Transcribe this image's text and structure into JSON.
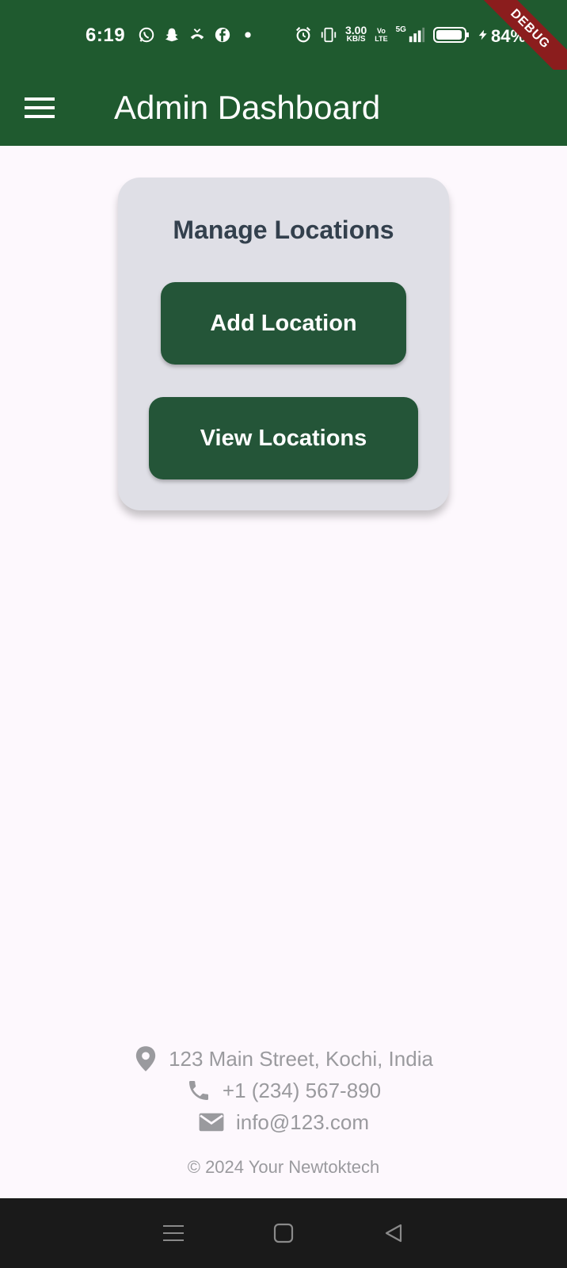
{
  "status_bar": {
    "time": "6:19",
    "net_speed_value": "3.00",
    "net_speed_unit": "KB/S",
    "volte_top": "Vo",
    "volte_bottom": "LTE",
    "network": "5G",
    "battery": "84%",
    "left_icons": [
      "whatsapp-icon",
      "snapchat-icon",
      "missed-call-icon",
      "facebook-icon",
      "dot-icon"
    ],
    "right_icons": [
      "alarm-icon",
      "vibrate-icon",
      "signal-icon",
      "battery-icon",
      "charging-icon"
    ]
  },
  "debug_banner": "DEBUG",
  "app_bar": {
    "title": "Admin Dashboard",
    "menu_icon": "menu-icon",
    "color": "#1f5a2f"
  },
  "card": {
    "title": "Manage Locations",
    "buttons": {
      "add": "Add Location",
      "view": "View Locations"
    },
    "button_color": "#245538"
  },
  "footer": {
    "address": "123 Main Street, Kochi, India",
    "phone": "+1 (234) 567-890",
    "email": "info@123.com",
    "copyright": "© 2024 Your Newtoktech",
    "icons": [
      "location-pin-icon",
      "phone-icon",
      "mail-icon"
    ]
  },
  "nav_bar": {
    "icons": [
      "recents-icon",
      "home-icon",
      "back-icon"
    ]
  }
}
